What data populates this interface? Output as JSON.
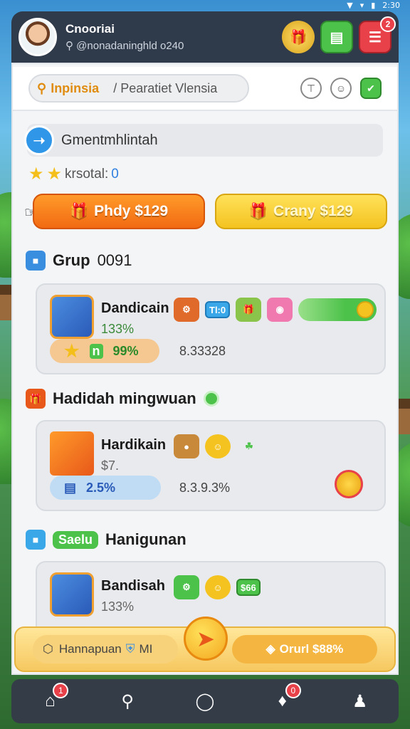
{
  "status_bar": {
    "time": "2:30"
  },
  "header": {
    "user_name": "Cnooriai",
    "user_handle": "@nonadaninghld o240",
    "menu_badge": "2"
  },
  "search": {
    "label": "Inpinsia",
    "placeholder": "/ Pearatiet Vlensia"
  },
  "greeting": {
    "text": "Gmentmhlintah"
  },
  "rating": {
    "label": "krsotal:",
    "value": "0"
  },
  "actions": {
    "primary": "Phdy $129",
    "secondary": "Crany $129"
  },
  "sections": [
    {
      "title": "Grup",
      "count": "0091",
      "card": {
        "title": "Dandicain",
        "subtitle": "133%",
        "tag": "Tl:0",
        "progress_label": "99%",
        "progress_code": "n",
        "trailing": "8.33328"
      }
    },
    {
      "title": "Hadidah mingwuan",
      "card": {
        "title": "Hardikain",
        "subtitle": "$7.",
        "progress_label": "2.5%",
        "trailing": "8.3.9.3%"
      }
    },
    {
      "title": "Hanigunan",
      "pill": "Saelu",
      "card": {
        "title": "Bandisah",
        "subtitle": "133%",
        "tag": "$66"
      }
    }
  ],
  "banner": {
    "left_text": "Hannapuan",
    "middle_text": "MI",
    "right_text": "Orurl $88%"
  },
  "nav": {
    "home_badge": "1",
    "notif_badge": "0"
  }
}
